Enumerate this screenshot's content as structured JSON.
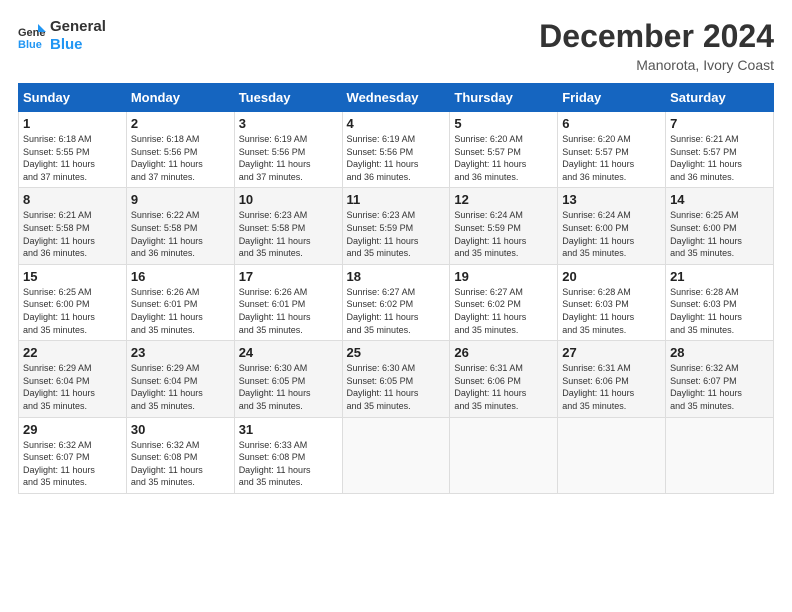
{
  "logo": {
    "line1": "General",
    "line2": "Blue"
  },
  "title": "December 2024",
  "subtitle": "Manorota, Ivory Coast",
  "days_header": [
    "Sunday",
    "Monday",
    "Tuesday",
    "Wednesday",
    "Thursday",
    "Friday",
    "Saturday"
  ],
  "weeks": [
    [
      {
        "day": "1",
        "info": "Sunrise: 6:18 AM\nSunset: 5:55 PM\nDaylight: 11 hours\nand 37 minutes."
      },
      {
        "day": "2",
        "info": "Sunrise: 6:18 AM\nSunset: 5:56 PM\nDaylight: 11 hours\nand 37 minutes."
      },
      {
        "day": "3",
        "info": "Sunrise: 6:19 AM\nSunset: 5:56 PM\nDaylight: 11 hours\nand 37 minutes."
      },
      {
        "day": "4",
        "info": "Sunrise: 6:19 AM\nSunset: 5:56 PM\nDaylight: 11 hours\nand 36 minutes."
      },
      {
        "day": "5",
        "info": "Sunrise: 6:20 AM\nSunset: 5:57 PM\nDaylight: 11 hours\nand 36 minutes."
      },
      {
        "day": "6",
        "info": "Sunrise: 6:20 AM\nSunset: 5:57 PM\nDaylight: 11 hours\nand 36 minutes."
      },
      {
        "day": "7",
        "info": "Sunrise: 6:21 AM\nSunset: 5:57 PM\nDaylight: 11 hours\nand 36 minutes."
      }
    ],
    [
      {
        "day": "8",
        "info": "Sunrise: 6:21 AM\nSunset: 5:58 PM\nDaylight: 11 hours\nand 36 minutes."
      },
      {
        "day": "9",
        "info": "Sunrise: 6:22 AM\nSunset: 5:58 PM\nDaylight: 11 hours\nand 36 minutes."
      },
      {
        "day": "10",
        "info": "Sunrise: 6:23 AM\nSunset: 5:58 PM\nDaylight: 11 hours\nand 35 minutes."
      },
      {
        "day": "11",
        "info": "Sunrise: 6:23 AM\nSunset: 5:59 PM\nDaylight: 11 hours\nand 35 minutes."
      },
      {
        "day": "12",
        "info": "Sunrise: 6:24 AM\nSunset: 5:59 PM\nDaylight: 11 hours\nand 35 minutes."
      },
      {
        "day": "13",
        "info": "Sunrise: 6:24 AM\nSunset: 6:00 PM\nDaylight: 11 hours\nand 35 minutes."
      },
      {
        "day": "14",
        "info": "Sunrise: 6:25 AM\nSunset: 6:00 PM\nDaylight: 11 hours\nand 35 minutes."
      }
    ],
    [
      {
        "day": "15",
        "info": "Sunrise: 6:25 AM\nSunset: 6:00 PM\nDaylight: 11 hours\nand 35 minutes."
      },
      {
        "day": "16",
        "info": "Sunrise: 6:26 AM\nSunset: 6:01 PM\nDaylight: 11 hours\nand 35 minutes."
      },
      {
        "day": "17",
        "info": "Sunrise: 6:26 AM\nSunset: 6:01 PM\nDaylight: 11 hours\nand 35 minutes."
      },
      {
        "day": "18",
        "info": "Sunrise: 6:27 AM\nSunset: 6:02 PM\nDaylight: 11 hours\nand 35 minutes."
      },
      {
        "day": "19",
        "info": "Sunrise: 6:27 AM\nSunset: 6:02 PM\nDaylight: 11 hours\nand 35 minutes."
      },
      {
        "day": "20",
        "info": "Sunrise: 6:28 AM\nSunset: 6:03 PM\nDaylight: 11 hours\nand 35 minutes."
      },
      {
        "day": "21",
        "info": "Sunrise: 6:28 AM\nSunset: 6:03 PM\nDaylight: 11 hours\nand 35 minutes."
      }
    ],
    [
      {
        "day": "22",
        "info": "Sunrise: 6:29 AM\nSunset: 6:04 PM\nDaylight: 11 hours\nand 35 minutes."
      },
      {
        "day": "23",
        "info": "Sunrise: 6:29 AM\nSunset: 6:04 PM\nDaylight: 11 hours\nand 35 minutes."
      },
      {
        "day": "24",
        "info": "Sunrise: 6:30 AM\nSunset: 6:05 PM\nDaylight: 11 hours\nand 35 minutes."
      },
      {
        "day": "25",
        "info": "Sunrise: 6:30 AM\nSunset: 6:05 PM\nDaylight: 11 hours\nand 35 minutes."
      },
      {
        "day": "26",
        "info": "Sunrise: 6:31 AM\nSunset: 6:06 PM\nDaylight: 11 hours\nand 35 minutes."
      },
      {
        "day": "27",
        "info": "Sunrise: 6:31 AM\nSunset: 6:06 PM\nDaylight: 11 hours\nand 35 minutes."
      },
      {
        "day": "28",
        "info": "Sunrise: 6:32 AM\nSunset: 6:07 PM\nDaylight: 11 hours\nand 35 minutes."
      }
    ],
    [
      {
        "day": "29",
        "info": "Sunrise: 6:32 AM\nSunset: 6:07 PM\nDaylight: 11 hours\nand 35 minutes."
      },
      {
        "day": "30",
        "info": "Sunrise: 6:32 AM\nSunset: 6:08 PM\nDaylight: 11 hours\nand 35 minutes."
      },
      {
        "day": "31",
        "info": "Sunrise: 6:33 AM\nSunset: 6:08 PM\nDaylight: 11 hours\nand 35 minutes."
      },
      {
        "day": "",
        "info": ""
      },
      {
        "day": "",
        "info": ""
      },
      {
        "day": "",
        "info": ""
      },
      {
        "day": "",
        "info": ""
      }
    ]
  ]
}
